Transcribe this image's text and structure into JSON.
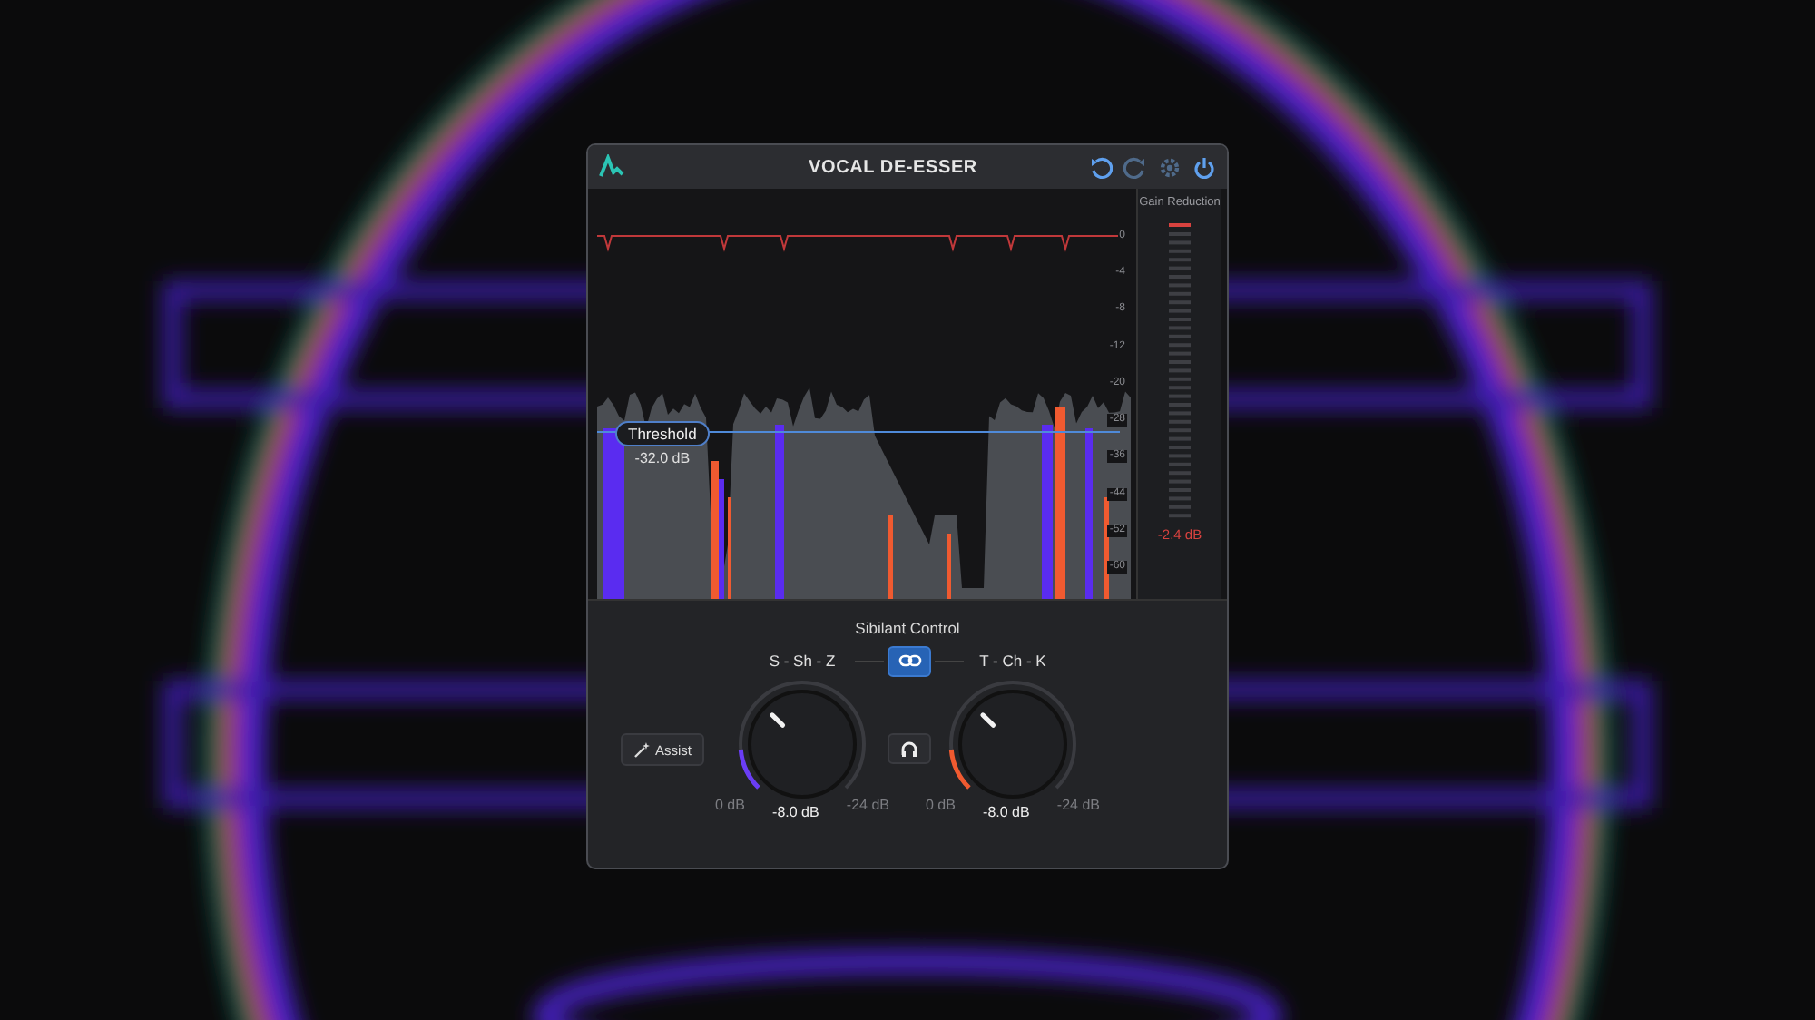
{
  "window": {
    "title": "VOCAL DE-ESSER"
  },
  "toolbar": [
    {
      "kind": "undo",
      "disabled": false
    },
    {
      "kind": "redo",
      "disabled": true
    },
    {
      "kind": "settings",
      "disabled": true
    },
    {
      "kind": "power",
      "disabled": false
    }
  ],
  "display": {
    "scale": [
      "0",
      "-4",
      "-8",
      "-12",
      "-20",
      "-28",
      "-36",
      "-44",
      "-52",
      "-60"
    ],
    "threshold": {
      "label": "Threshold",
      "value": "-32.0 dB"
    }
  },
  "gain_reduction": {
    "title": "Gain Reduction",
    "reading": "-2.4 dB"
  },
  "section_title": "Sibilant Control",
  "link": {
    "on": true
  },
  "assist": {
    "label": "Assist"
  },
  "listen": {
    "on": false
  },
  "knobs": [
    {
      "label": "S - Sh - Z",
      "min": "0 dB",
      "value": "-8.0 dB",
      "max": "-24 dB",
      "level": 0.33,
      "color": "#6a3df5"
    },
    {
      "label": "T - Ch - K",
      "min": "0 dB",
      "value": "-8.0 dB",
      "max": "-24 dB",
      "level": 0.33,
      "color": "#f05a30"
    }
  ]
}
